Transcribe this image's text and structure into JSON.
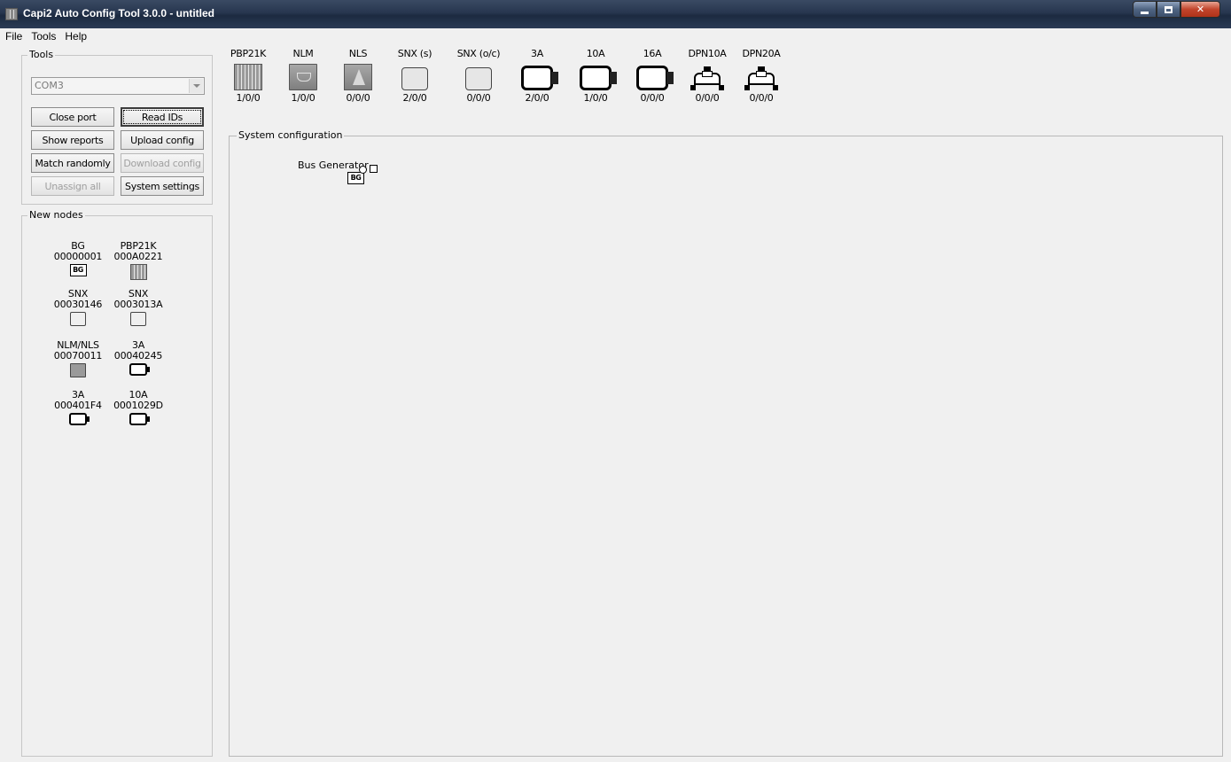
{
  "window": {
    "title": "Capi2 Auto Config Tool 3.0.0 - untitled"
  },
  "menu": [
    "File",
    "Tools",
    "Help"
  ],
  "tools": {
    "legend": "Tools",
    "port": "COM3",
    "buttons": {
      "close_port": "Close port",
      "read_ids": "Read IDs",
      "show_reports": "Show reports",
      "upload_config": "Upload config",
      "match_randomly": "Match randomly",
      "download_config": "Download config",
      "unassign_all": "Unassign all",
      "system_settings": "System settings"
    }
  },
  "new_nodes": {
    "legend": "New nodes",
    "items": [
      {
        "type": "BG",
        "id": "00000001",
        "icon": "bg-icon"
      },
      {
        "type": "PBP21K",
        "id": "000A0221",
        "icon": "pbp21k-icon"
      },
      {
        "type": "SNX",
        "id": "00030146",
        "icon": "snx-icon"
      },
      {
        "type": "SNX",
        "id": "0003013A",
        "icon": "snx-icon"
      },
      {
        "type": "NLM/NLS",
        "id": "00070011",
        "icon": "nlm-icon"
      },
      {
        "type": "3A",
        "id": "00040245",
        "icon": "module-icon"
      },
      {
        "type": "3A",
        "id": "000401F4",
        "icon": "module-icon"
      },
      {
        "type": "10A",
        "id": "0001029D",
        "icon": "module-icon"
      }
    ]
  },
  "palette": [
    {
      "label": "PBP21K",
      "count": "1/0/0",
      "icon": "pbp21k-icon"
    },
    {
      "label": "NLM",
      "count": "1/0/0",
      "icon": "nlm-icon"
    },
    {
      "label": "NLS",
      "count": "0/0/0",
      "icon": "nls-icon"
    },
    {
      "label": "SNX (s)",
      "count": "2/0/0",
      "icon": "snx-icon"
    },
    {
      "label": "SNX (o/c)",
      "count": "0/0/0",
      "icon": "snx-icon"
    },
    {
      "label": "3A",
      "count": "2/0/0",
      "icon": "module-icon"
    },
    {
      "label": "10A",
      "count": "1/0/0",
      "icon": "module-icon"
    },
    {
      "label": "16A",
      "count": "0/0/0",
      "icon": "module-icon"
    },
    {
      "label": "DPN10A",
      "count": "0/0/0",
      "icon": "dpn-icon"
    },
    {
      "label": "DPN20A",
      "count": "0/0/0",
      "icon": "dpn-icon"
    }
  ],
  "system_configuration": {
    "legend": "System configuration",
    "bus_generator_label": "Bus Generator -",
    "bus_generator_icon_text": "BG"
  }
}
